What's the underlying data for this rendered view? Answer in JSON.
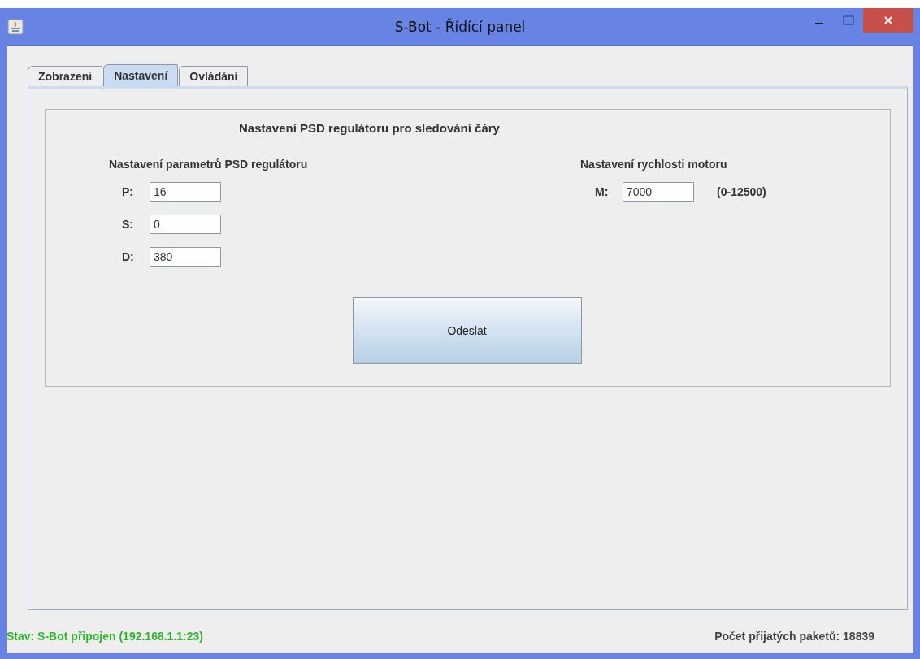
{
  "window": {
    "title": "S-Bot - Řídící panel"
  },
  "tabs": [
    {
      "label": "Zobrazeni",
      "selected": false
    },
    {
      "label": "Nastavení",
      "selected": true
    },
    {
      "label": "Ovládání",
      "selected": false
    }
  ],
  "panel": {
    "title": "Nastavení PSD regulátoru pro sledování čáry",
    "pid": {
      "heading": "Nastavení parametrů PSD regulátoru",
      "fields": [
        {
          "label": "P:",
          "value": "16"
        },
        {
          "label": "S:",
          "value": "0"
        },
        {
          "label": "D:",
          "value": "380"
        }
      ]
    },
    "motor": {
      "heading": "Nastavení rychlosti motoru",
      "label": "M:",
      "value": "7000",
      "range": "(0-12500)"
    },
    "send_button": "Odeslat"
  },
  "status_bar": {
    "status": "Stav: S-Bot připojen (192.168.1.1:23)",
    "packets": "Počet přijatých paketů: 18839"
  }
}
